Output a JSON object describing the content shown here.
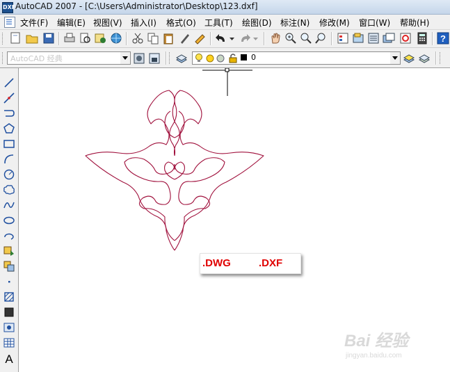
{
  "window": {
    "app_icon": "autocad-dxf-icon",
    "title": "AutoCAD 2007 - [C:\\Users\\Administrator\\Desktop\\123.dxf]"
  },
  "menu": {
    "doc_icon": "document-icon",
    "items": [
      {
        "label": "文件(F)"
      },
      {
        "label": "编辑(E)"
      },
      {
        "label": "视图(V)"
      },
      {
        "label": "插入(I)"
      },
      {
        "label": "格式(O)"
      },
      {
        "label": "工具(T)"
      },
      {
        "label": "绘图(D)"
      },
      {
        "label": "标注(N)"
      },
      {
        "label": "修改(M)"
      },
      {
        "label": "窗口(W)"
      },
      {
        "label": "帮助(H)"
      }
    ]
  },
  "toolbar2": {
    "workspace_value": "AutoCAD 经典",
    "layer_value": "0"
  },
  "colors": {
    "drawing_line": "#a0103c",
    "badge_text": "#e00000"
  },
  "badge": {
    "left": ".DWG",
    "right": ".DXF"
  },
  "watermark": {
    "brand": "Bai 经验",
    "url": "jingyan.baidu.com"
  }
}
